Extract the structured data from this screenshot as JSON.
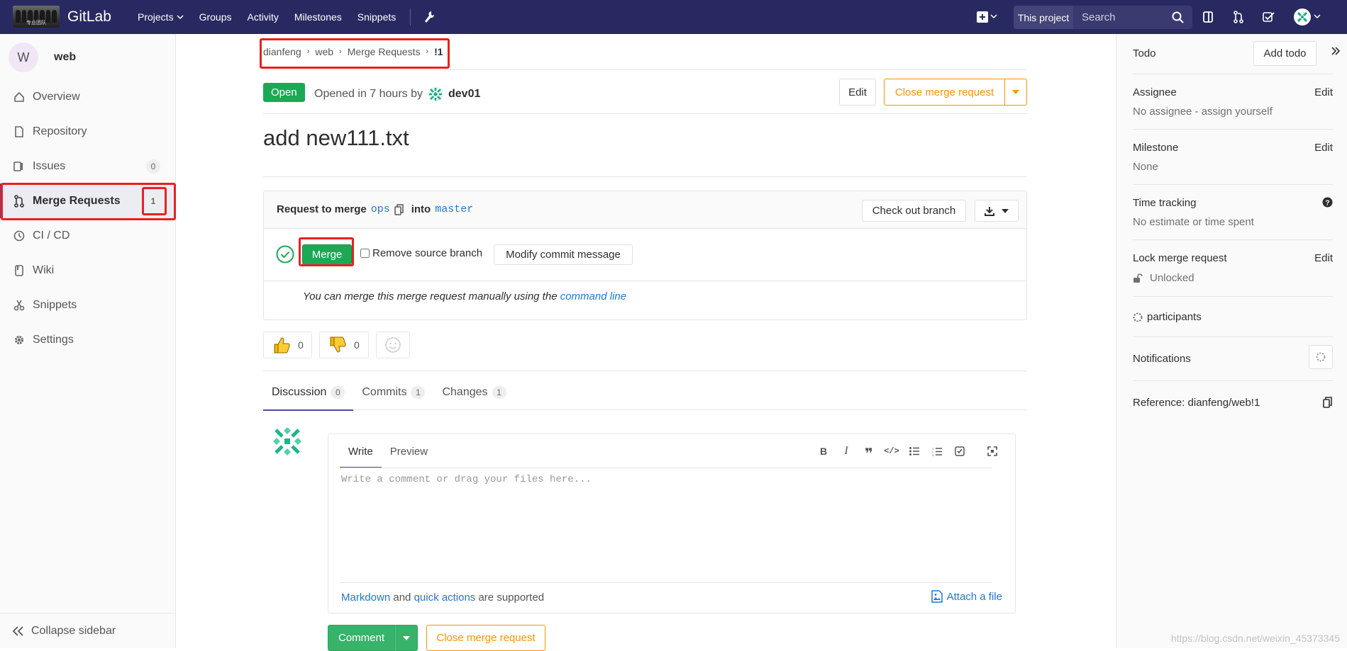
{
  "navbar": {
    "brand": "GitLab",
    "logo_caption": "专业团队",
    "links": [
      "Projects",
      "Groups",
      "Activity",
      "Milestones",
      "Snippets"
    ],
    "scope": "This project",
    "search_placeholder": "Search"
  },
  "sidebar": {
    "avatar_letter": "W",
    "project_name": "web",
    "items": [
      {
        "label": "Overview",
        "icon": "home-icon"
      },
      {
        "label": "Repository",
        "icon": "doc-icon"
      },
      {
        "label": "Issues",
        "icon": "issues-icon",
        "badge": "0"
      },
      {
        "label": "Merge Requests",
        "icon": "merge-request-icon",
        "badge": "1",
        "active": true
      },
      {
        "label": "CI / CD",
        "icon": "rocket-icon"
      },
      {
        "label": "Wiki",
        "icon": "book-icon"
      },
      {
        "label": "Snippets",
        "icon": "scissors-icon"
      },
      {
        "label": "Settings",
        "icon": "gear-icon"
      }
    ],
    "collapse_label": "Collapse sidebar"
  },
  "breadcrumb": [
    "dianfeng",
    "web",
    "Merge Requests",
    "!1"
  ],
  "header": {
    "status": "Open",
    "opened_text": "Opened in 7 hours by",
    "author": "dev01",
    "edit_label": "Edit",
    "close_label": "Close merge request"
  },
  "title": "add new111.txt",
  "widget": {
    "request_prefix": "Request to merge",
    "source_branch": "ops",
    "into": "into",
    "target_branch": "master",
    "checkout_label": "Check out branch",
    "merge_label": "Merge",
    "remove_source_label": "Remove source branch",
    "modify_commit_label": "Modify commit message",
    "manual_text": "You can merge this merge request manually using the",
    "command_line_link": "command line"
  },
  "awards": {
    "thumbsup": "0",
    "thumbsdown": "0"
  },
  "tabs": [
    {
      "label": "Discussion",
      "count": "0",
      "active": true
    },
    {
      "label": "Commits",
      "count": "1"
    },
    {
      "label": "Changes",
      "count": "1"
    }
  ],
  "note": {
    "write_tab": "Write",
    "preview_tab": "Preview",
    "placeholder": "Write a comment or drag your files here...",
    "markdown_link": "Markdown",
    "and_text": "and",
    "quick_actions_link": "quick actions",
    "supported_text": "are supported",
    "attach_label": "Attach a file",
    "comment_label": "Comment",
    "close_label": "Close merge request"
  },
  "right_sidebar": {
    "todo_label": "Todo",
    "add_todo_label": "Add todo",
    "assignee_title": "Assignee",
    "assignee_value": "No assignee - assign yourself",
    "milestone_title": "Milestone",
    "milestone_value": "None",
    "time_tracking_title": "Time tracking",
    "time_tracking_value": "No estimate or time spent",
    "lock_title": "Lock merge request",
    "lock_value": "Unlocked",
    "participants_label": "participants",
    "notifications_label": "Notifications",
    "reference_label": "Reference: dianfeng/web!1",
    "edit_label": "Edit"
  },
  "watermark": "https://blog.csdn.net/weixin_45373345",
  "colors": {
    "navbar": "#292961",
    "success": "#1aaa55",
    "warning": "#fc9403",
    "link": "#1f78d1",
    "annotation": "#e8211f"
  }
}
